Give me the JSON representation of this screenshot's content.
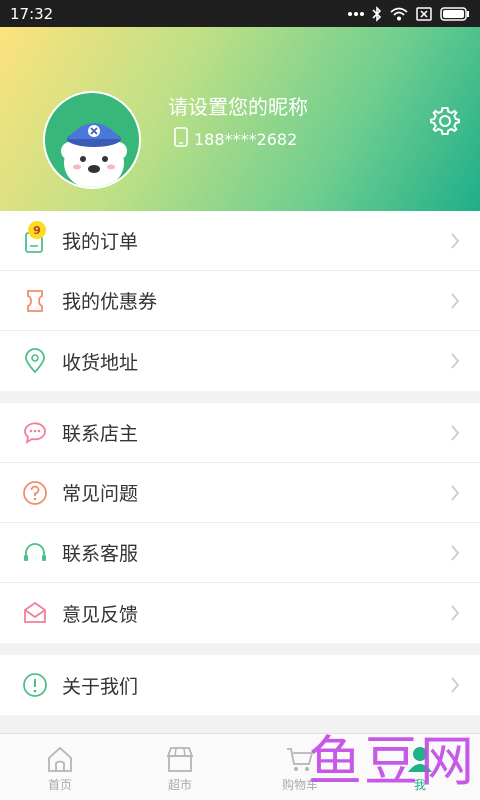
{
  "status_bar": {
    "time": "17:32"
  },
  "profile": {
    "nickname": "请设置您的昵称",
    "phone": "188****2682"
  },
  "menu_group_1": [
    {
      "label": "我的订单",
      "icon": "order-icon",
      "badge": "9"
    },
    {
      "label": "我的优惠券",
      "icon": "coupon-icon"
    },
    {
      "label": "收货地址",
      "icon": "location-icon"
    }
  ],
  "menu_group_2": [
    {
      "label": "联系店主",
      "icon": "chat-icon"
    },
    {
      "label": "常见问题",
      "icon": "question-icon"
    },
    {
      "label": "联系客服",
      "icon": "headset-icon"
    },
    {
      "label": "意见反馈",
      "icon": "envelope-icon"
    }
  ],
  "menu_group_3": [
    {
      "label": "关于我们",
      "icon": "info-icon"
    }
  ],
  "tabbar": [
    {
      "label": "首页",
      "icon": "home-icon"
    },
    {
      "label": "超市",
      "icon": "store-icon"
    },
    {
      "label": "购物车",
      "icon": "cart-icon"
    },
    {
      "label": "我",
      "icon": "person-icon",
      "active": true
    }
  ],
  "watermark": "鱼豆网",
  "colors": {
    "accent": "#20b189",
    "badge": "#fbdc23",
    "header_start": "#fde27d",
    "header_end": "#1fae8a"
  }
}
